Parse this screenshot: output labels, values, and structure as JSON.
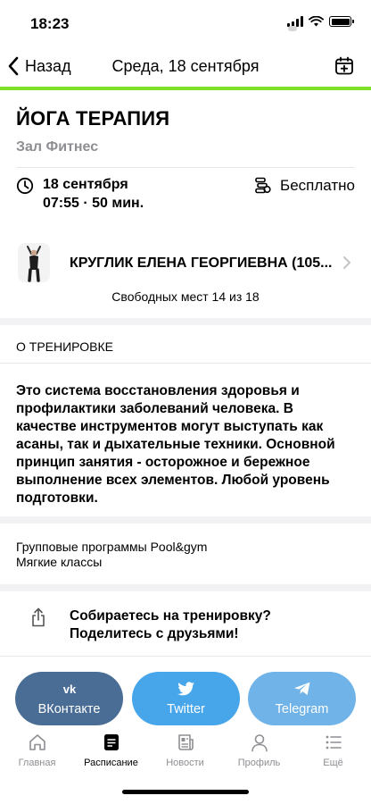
{
  "status_bar": {
    "time": "18:23"
  },
  "nav": {
    "back_label": "Назад",
    "title": "Среда, 18 сентября"
  },
  "colors": {
    "accent": "#7ee02a",
    "vk": "#4a6d96",
    "twitter": "#47a6ea",
    "telegram": "#6fb3e8",
    "muted": "#8e8e93"
  },
  "workout": {
    "title": "ЙОГА ТЕРАПИЯ",
    "hall": "Зал Фитнес",
    "date": "18 сентября",
    "time": "07:55 · 50 мин.",
    "price": "Бесплатно",
    "trainer": "КРУГЛИК ЕЛЕНА ГЕОРГИЕВНА (105...",
    "free_places": "Свободных мест 14 из 18"
  },
  "about": {
    "header": "О ТРЕНИРОВКЕ",
    "description": "Это система восстановления здоровья и профилактики заболеваний человека. В качестве инструментов могут выступать как асаны, так и дыхательные техники. Основной принцип занятия - осторожное и бережное выполнение всех элементов. Любой уровень подготовки."
  },
  "tags": [
    "Групповые программы Pool&gym",
    "Мягкие классы"
  ],
  "share": {
    "line1": "Собираетесь на тренировку?",
    "line2": "Поделитесь с друзьями!",
    "icon": "share-icon"
  },
  "social": {
    "vk": "ВКонтакте",
    "twitter": "Twitter",
    "telegram": "Telegram"
  },
  "tabs": [
    {
      "label": "Главная",
      "icon": "home-icon",
      "active": false
    },
    {
      "label": "Расписание",
      "icon": "schedule-icon",
      "active": true
    },
    {
      "label": "Новости",
      "icon": "news-icon",
      "active": false
    },
    {
      "label": "Профиль",
      "icon": "profile-icon",
      "active": false
    },
    {
      "label": "Ещё",
      "icon": "more-icon",
      "active": false
    }
  ]
}
